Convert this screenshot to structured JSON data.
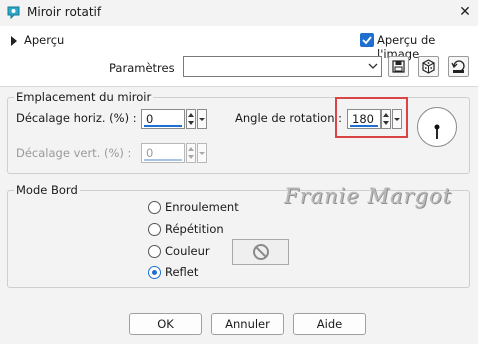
{
  "window": {
    "title": "Miroir rotatif",
    "close_glyph": "✕"
  },
  "top": {
    "apercu_label": "Aperçu",
    "apercu_image_label": "Aperçu de l'image",
    "apercu_image_checked": true,
    "params_label": "Paramètres",
    "params_value": ""
  },
  "placement": {
    "title": "Emplacement du miroir",
    "decalage_horiz_label": "Décalage horiz. (%) :",
    "decalage_horiz_value": "0",
    "decalage_vert_label": "Décalage vert. (%) :",
    "decalage_vert_value": "0",
    "angle_label": "Angle de rotation :",
    "angle_value": "180"
  },
  "mode_bord": {
    "title": "Mode Bord",
    "options": [
      "Enroulement",
      "Répétition",
      "Couleur",
      "Reflet"
    ],
    "selected": "Reflet"
  },
  "watermark": "Franie Margot",
  "buttons": {
    "ok": "OK",
    "cancel": "Annuler",
    "help": "Aide"
  },
  "colors": {
    "accent": "#1e6fd0",
    "highlight": "#d94444",
    "dialog_bg": "#f3f3f3"
  }
}
